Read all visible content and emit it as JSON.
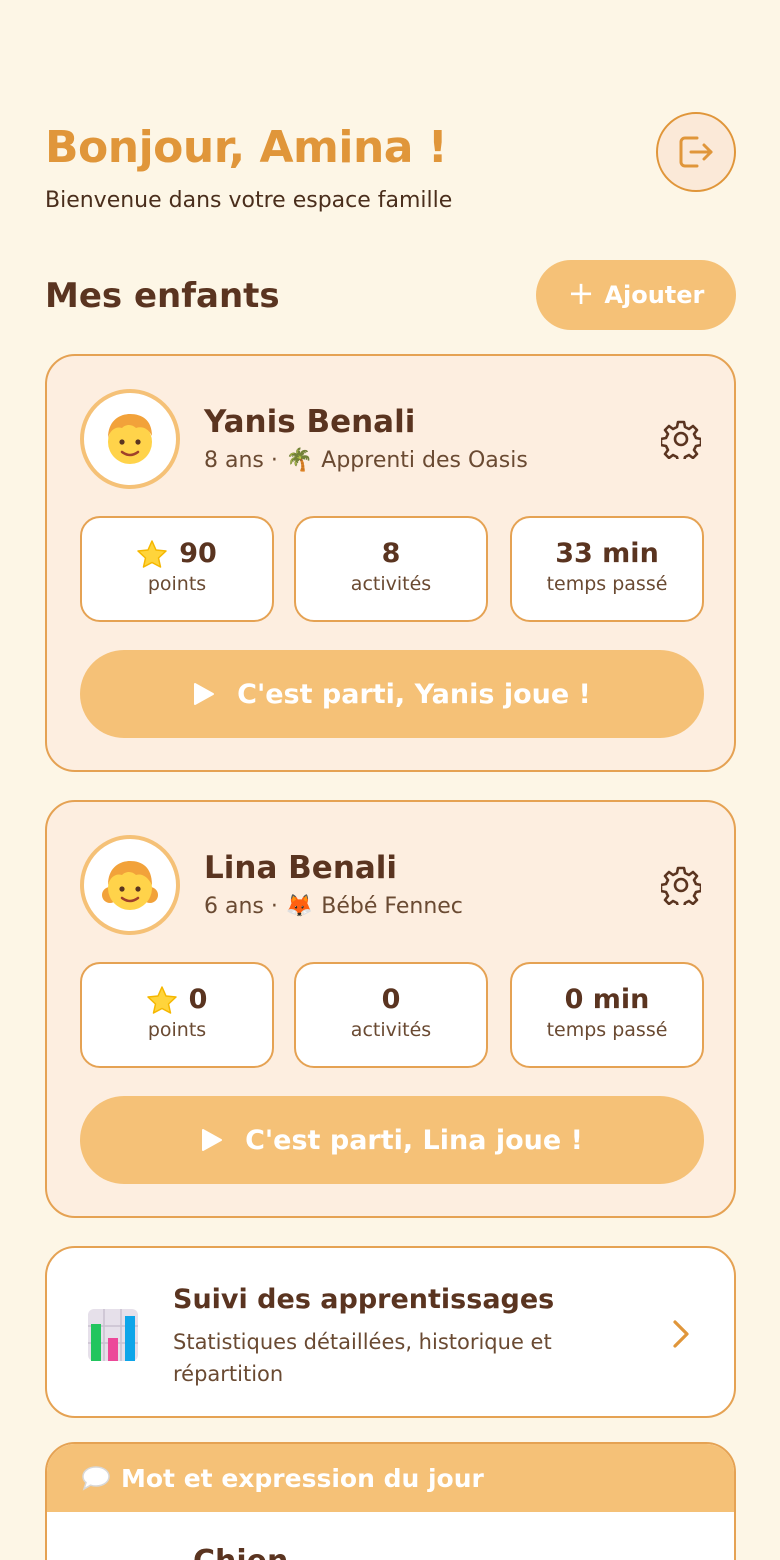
{
  "header": {
    "greeting": "Bonjour, Amina !",
    "subtitle": "Bienvenue dans votre espace famille",
    "logout_icon": "logout-icon"
  },
  "children_section": {
    "title": "Mes enfants",
    "add_label": "Ajouter"
  },
  "children": [
    {
      "name": "Yanis Benali",
      "age": "8 ans ·",
      "level_icon": "🌴",
      "level": "Apprenti des Oasis",
      "avatar": "👦",
      "points": "90",
      "points_label": "points",
      "activities": "8",
      "activities_label": "activités",
      "time": "33 min",
      "time_label": "temps passé",
      "play_label": "C'est parti, Yanis joue !"
    },
    {
      "name": "Lina Benali",
      "age": "6 ans ·",
      "level_icon": "🦊",
      "level": "Bébé Fennec",
      "avatar": "👧",
      "points": "0",
      "points_label": "points",
      "activities": "0",
      "activities_label": "activités",
      "time": "0 min",
      "time_label": "temps passé",
      "play_label": "C'est parti, Lina joue !"
    }
  ],
  "tracking": {
    "title": "Suivi des apprentissages",
    "description": "Statistiques détaillées, historique et répartition"
  },
  "word_of_day": {
    "header": "Mot et expression du jour",
    "word": "Chien"
  },
  "colors": {
    "background": "#fdf6e6",
    "accent": "#e0963a",
    "button": "#f5c177",
    "text": "#5a3420"
  }
}
